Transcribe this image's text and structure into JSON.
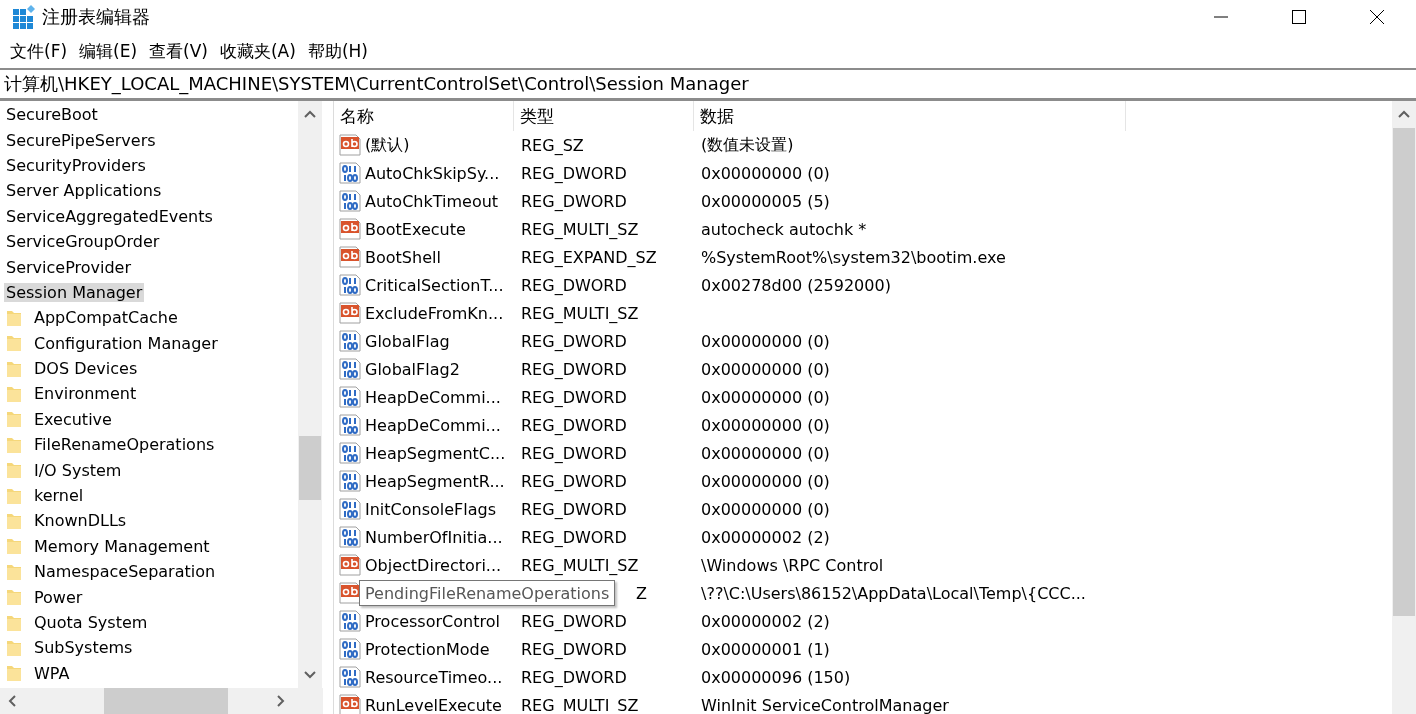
{
  "window": {
    "title": "注册表编辑器"
  },
  "menu": [
    {
      "label": "文件(F)"
    },
    {
      "label": "编辑(E)"
    },
    {
      "label": "查看(V)"
    },
    {
      "label": "收藏夹(A)"
    },
    {
      "label": "帮助(H)"
    }
  ],
  "address": {
    "value": "计算机\\HKEY_LOCAL_MACHINE\\SYSTEM\\CurrentControlSet\\Control\\Session Manager"
  },
  "tree": [
    {
      "label": "SecureBoot",
      "selected": false
    },
    {
      "label": "SecurePipeServers",
      "selected": false
    },
    {
      "label": "SecurityProviders",
      "selected": false
    },
    {
      "label": "Server Applications",
      "selected": false
    },
    {
      "label": "ServiceAggregatedEvents",
      "selected": false
    },
    {
      "label": "ServiceGroupOrder",
      "selected": false
    },
    {
      "label": "ServiceProvider",
      "selected": false
    },
    {
      "label": "Session Manager",
      "selected": true,
      "children": [
        {
          "label": "AppCompatCache",
          "selected": false
        },
        {
          "label": "Configuration Manager",
          "selected": false
        },
        {
          "label": "DOS Devices",
          "selected": false
        },
        {
          "label": "Environment",
          "selected": false
        },
        {
          "label": "Executive",
          "selected": false
        },
        {
          "label": "FileRenameOperations",
          "selected": false
        },
        {
          "label": "I/O System",
          "selected": false
        },
        {
          "label": "kernel",
          "selected": false
        },
        {
          "label": "KnownDLLs",
          "selected": false
        },
        {
          "label": "Memory Management",
          "selected": false
        },
        {
          "label": "NamespaceSeparation",
          "selected": false
        },
        {
          "label": "Power",
          "selected": false
        },
        {
          "label": "Quota System",
          "selected": false
        },
        {
          "label": "SubSystems",
          "selected": false
        },
        {
          "label": "WPA",
          "selected": false
        }
      ]
    }
  ],
  "table": {
    "columns": [
      "名称",
      "类型",
      "数据"
    ],
    "rows": [
      {
        "kind": "string",
        "name": "(默认)",
        "type": "REG_SZ",
        "data": "(数值未设置)"
      },
      {
        "kind": "binary",
        "name": "AutoChkSkipSy...",
        "type": "REG_DWORD",
        "data": "0x00000000 (0)"
      },
      {
        "kind": "binary",
        "name": "AutoChkTimeout",
        "type": "REG_DWORD",
        "data": "0x00000005 (5)"
      },
      {
        "kind": "string",
        "name": "BootExecute",
        "type": "REG_MULTI_SZ",
        "data": "autocheck autochk *"
      },
      {
        "kind": "string",
        "name": "BootShell",
        "type": "REG_EXPAND_SZ",
        "data": "%SystemRoot%\\system32\\bootim.exe"
      },
      {
        "kind": "binary",
        "name": "CriticalSectionT...",
        "type": "REG_DWORD",
        "data": "0x00278d00 (2592000)"
      },
      {
        "kind": "string",
        "name": "ExcludeFromKn...",
        "type": "REG_MULTI_SZ"
      },
      {
        "kind": "binary",
        "name": "GlobalFlag",
        "type": "REG_DWORD",
        "data": "0x00000000 (0)"
      },
      {
        "kind": "binary",
        "name": "GlobalFlag2",
        "type": "REG_DWORD",
        "data": "0x00000000 (0)"
      },
      {
        "kind": "binary",
        "name": "HeapDeCommi...",
        "type": "REG_DWORD",
        "data": "0x00000000 (0)"
      },
      {
        "kind": "binary",
        "name": "HeapDeCommi...",
        "type": "REG_DWORD",
        "data": "0x00000000 (0)"
      },
      {
        "kind": "binary",
        "name": "HeapSegmentC...",
        "type": "REG_DWORD",
        "data": "0x00000000 (0)"
      },
      {
        "kind": "binary",
        "name": "HeapSegmentR...",
        "type": "REG_DWORD",
        "data": "0x00000000 (0)"
      },
      {
        "kind": "binary",
        "name": "InitConsoleFlags",
        "type": "REG_DWORD",
        "data": "0x00000000 (0)"
      },
      {
        "kind": "binary",
        "name": "NumberOfInitia...",
        "type": "REG_DWORD",
        "data": "0x00000002 (2)"
      },
      {
        "kind": "string",
        "name": "ObjectDirectori...",
        "type": "REG_MULTI_SZ",
        "data": "\\Windows \\RPC Control"
      },
      {
        "kind": "string",
        "tooltip": "PendingFileRenameOperations",
        "type": "Z",
        "data": "\\??\\C:\\Users\\86152\\AppData\\Local\\Temp\\{CCC..."
      },
      {
        "kind": "binary",
        "name": "ProcessorControl",
        "type": "REG_DWORD",
        "data": "0x00000002 (2)"
      },
      {
        "kind": "binary",
        "name": "ProtectionMode",
        "type": "REG_DWORD",
        "data": "0x00000001 (1)"
      },
      {
        "kind": "binary",
        "name": "ResourceTimeo...",
        "type": "REG_DWORD",
        "data": "0x00000096 (150)"
      },
      {
        "kind": "string",
        "name": "RunLevelExecute",
        "type": "REG_MULTI_SZ",
        "data": "WinInit ServiceControlManager"
      }
    ]
  }
}
